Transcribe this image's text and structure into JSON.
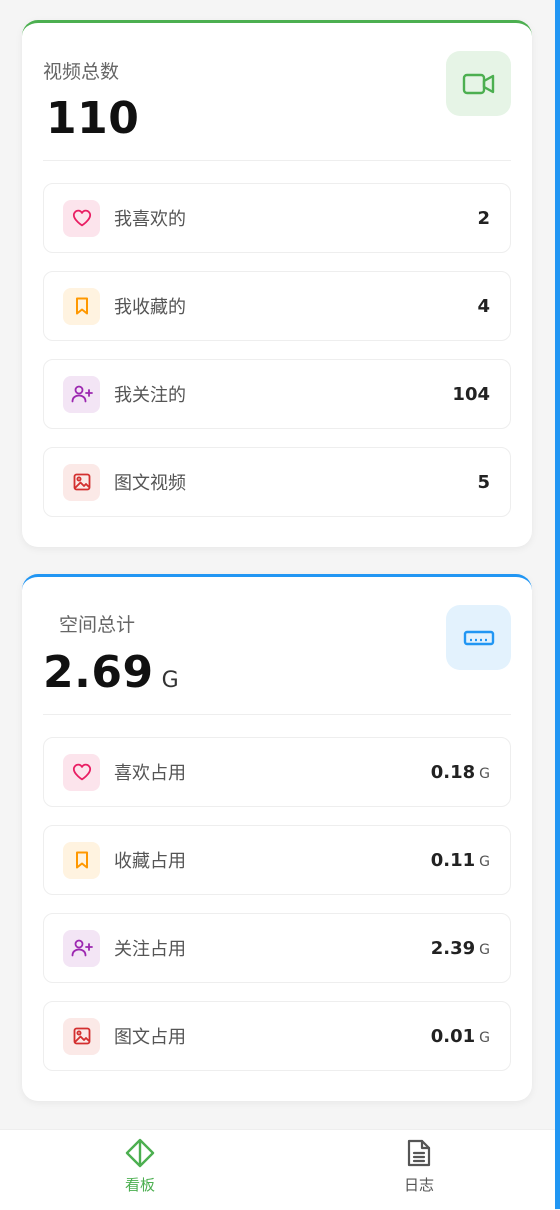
{
  "colors": {
    "videos_accent": "#4caf50",
    "space_accent": "#2196f3",
    "nav_active": "#4caf50",
    "nav_inactive": "#555555",
    "heart": "#e91e63",
    "bookmark": "#ff9800",
    "follow": "#9c27b0",
    "image": "#d32f2f"
  },
  "videos": {
    "title": "视频总数",
    "total": "110",
    "icon": "video-camera-icon",
    "rows": [
      {
        "icon": "heart-icon",
        "label": "我喜欢的",
        "value": "2"
      },
      {
        "icon": "bookmark-icon",
        "label": "我收藏的",
        "value": "4"
      },
      {
        "icon": "user-plus-icon",
        "label": "我关注的",
        "value": "104"
      },
      {
        "icon": "image-icon",
        "label": "图文视频",
        "value": "5"
      }
    ]
  },
  "space": {
    "title": "空间总计",
    "total": "2.69",
    "unit": "G",
    "icon": "hard-drive-icon",
    "rows": [
      {
        "icon": "heart-icon",
        "label": "喜欢占用",
        "value": "0.18",
        "unit": "G"
      },
      {
        "icon": "bookmark-icon",
        "label": "收藏占用",
        "value": "0.11",
        "unit": "G"
      },
      {
        "icon": "user-plus-icon",
        "label": "关注占用",
        "value": "2.39",
        "unit": "G"
      },
      {
        "icon": "image-icon",
        "label": "图文占用",
        "value": "0.01",
        "unit": "G"
      }
    ]
  },
  "nav": {
    "items": [
      {
        "label": "看板",
        "icon": "dashboard-diamond-icon",
        "active": true
      },
      {
        "label": "日志",
        "icon": "document-icon",
        "active": false
      }
    ]
  }
}
